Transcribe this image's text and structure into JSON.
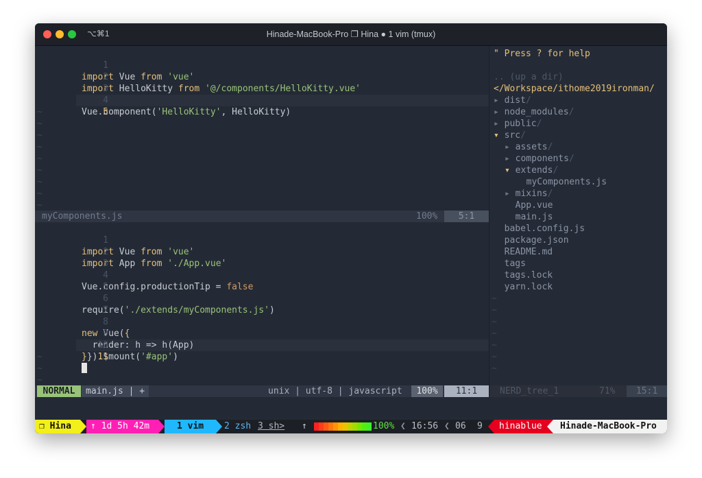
{
  "window": {
    "shortcut": "⌥⌘1",
    "title": "Hinade-MacBook-Pro ❐ Hina ● 1 vim (tmux)"
  },
  "top_pane": {
    "lines": [
      {
        "n": "1",
        "parts": [
          [
            "kw",
            "import"
          ],
          [
            "",
            "Vue"
          ],
          [
            "kw",
            "from"
          ],
          [
            "str",
            "'vue'"
          ]
        ]
      },
      {
        "n": "2",
        "parts": [
          [
            "kw",
            "import"
          ],
          [
            "",
            "HelloKitty"
          ],
          [
            "kw",
            "from"
          ],
          [
            "str",
            "'@/components/HelloKitty.vue'"
          ]
        ]
      },
      {
        "n": "3",
        "parts": []
      },
      {
        "n": "4",
        "text": "Vue.component(",
        "str": "'HelloKitty'",
        "rest": ", HelloKitty)"
      },
      {
        "n": "5",
        "parts": []
      }
    ],
    "tilde": "~"
  },
  "status_top": {
    "filename": "myComponents.js",
    "percent": "100%",
    "position": "5:1"
  },
  "bottom_pane": {
    "l1": {
      "n": "1",
      "kw1": "import",
      "a": " Vue ",
      "kw2": "from",
      "s": "'vue'"
    },
    "l2": {
      "n": "2",
      "kw1": "import",
      "a": " App ",
      "kw2": "from",
      "s": "'./App.vue'"
    },
    "l3": {
      "n": "3"
    },
    "l4": {
      "n": "4",
      "a": "Vue.config.productionTip = ",
      "b": "false"
    },
    "l5": {
      "n": "5"
    },
    "l6": {
      "n": "6",
      "a": "require(",
      "s": "'./extends/myComponents.js'",
      "b": ")"
    },
    "l7": {
      "n": "7"
    },
    "l8": {
      "n": "8",
      "kw": "new",
      "a": " Vue(",
      "b": "{"
    },
    "l9": {
      "n": "9",
      "a": "  render: h => h(App)"
    },
    "l10": {
      "n": "10",
      "a": "}).$mount(",
      "s": "'#app'",
      "b": ")"
    },
    "l11": {
      "n": "11"
    }
  },
  "status_bottom": {
    "mode": "NORMAL",
    "file": "main.js | +",
    "info": "unix | utf-8 | javascript",
    "percent": "100%",
    "position": "11:1"
  },
  "tree": {
    "help": "\" Press ? for help",
    "up": ".. (up a dir)",
    "root": "</Workspace/ithome2019ironman/",
    "items": [
      {
        "marker": "▸",
        "name": "dist",
        "slash": "/",
        "depth": 0,
        "open": false
      },
      {
        "marker": "▸",
        "name": "node_modules",
        "slash": "/",
        "depth": 0,
        "open": false
      },
      {
        "marker": "▸",
        "name": "public",
        "slash": "/",
        "depth": 0,
        "open": false
      },
      {
        "marker": "▾",
        "name": "src",
        "slash": "/",
        "depth": 0,
        "open": true
      },
      {
        "marker": "▸",
        "name": "assets",
        "slash": "/",
        "depth": 1,
        "open": false
      },
      {
        "marker": "▸",
        "name": "components",
        "slash": "/",
        "depth": 1,
        "open": false
      },
      {
        "marker": "▾",
        "name": "extends",
        "slash": "/",
        "depth": 1,
        "open": true
      },
      {
        "marker": "",
        "name": "myComponents.js",
        "slash": "",
        "depth": 2,
        "open": false
      },
      {
        "marker": "▸",
        "name": "mixins",
        "slash": "/",
        "depth": 1,
        "open": false
      },
      {
        "marker": "",
        "name": "App.vue",
        "slash": "",
        "depth": 1,
        "open": false
      },
      {
        "marker": "",
        "name": "main.js",
        "slash": "",
        "depth": 1,
        "open": false
      },
      {
        "marker": "",
        "name": "babel.config.js",
        "slash": "",
        "depth": 0,
        "open": false
      },
      {
        "marker": "",
        "name": "package.json",
        "slash": "",
        "depth": 0,
        "open": false
      },
      {
        "marker": "",
        "name": "README.md",
        "slash": "",
        "depth": 0,
        "open": false
      },
      {
        "marker": "",
        "name": "tags",
        "slash": "",
        "depth": 0,
        "open": false
      },
      {
        "marker": "",
        "name": "tags.lock",
        "slash": "",
        "depth": 0,
        "open": false
      },
      {
        "marker": "",
        "name": "yarn.lock",
        "slash": "",
        "depth": 0,
        "open": false
      }
    ]
  },
  "status_tree": {
    "name": "NERD_tree_1",
    "percent": "71%",
    "position": "15:1"
  },
  "tmux": {
    "session": "❐ Hina",
    "uptime": "↑ 1d 5h 42m",
    "window_active": "1 vim",
    "window_other": "2 zsh",
    "window_other2": "3 sh>",
    "battery_arrow": "↑",
    "battery_pct": "100%",
    "time": "16:56",
    "day": "06",
    "month": "9",
    "user": "hinablue",
    "host": "Hinade-MacBook-Pro",
    "colors": {
      "session": "#f3ef1a",
      "uptime": "#ff1fb4",
      "window": "#1fb8ff",
      "user": "#e5001f",
      "host": "#f2f2f2"
    }
  }
}
